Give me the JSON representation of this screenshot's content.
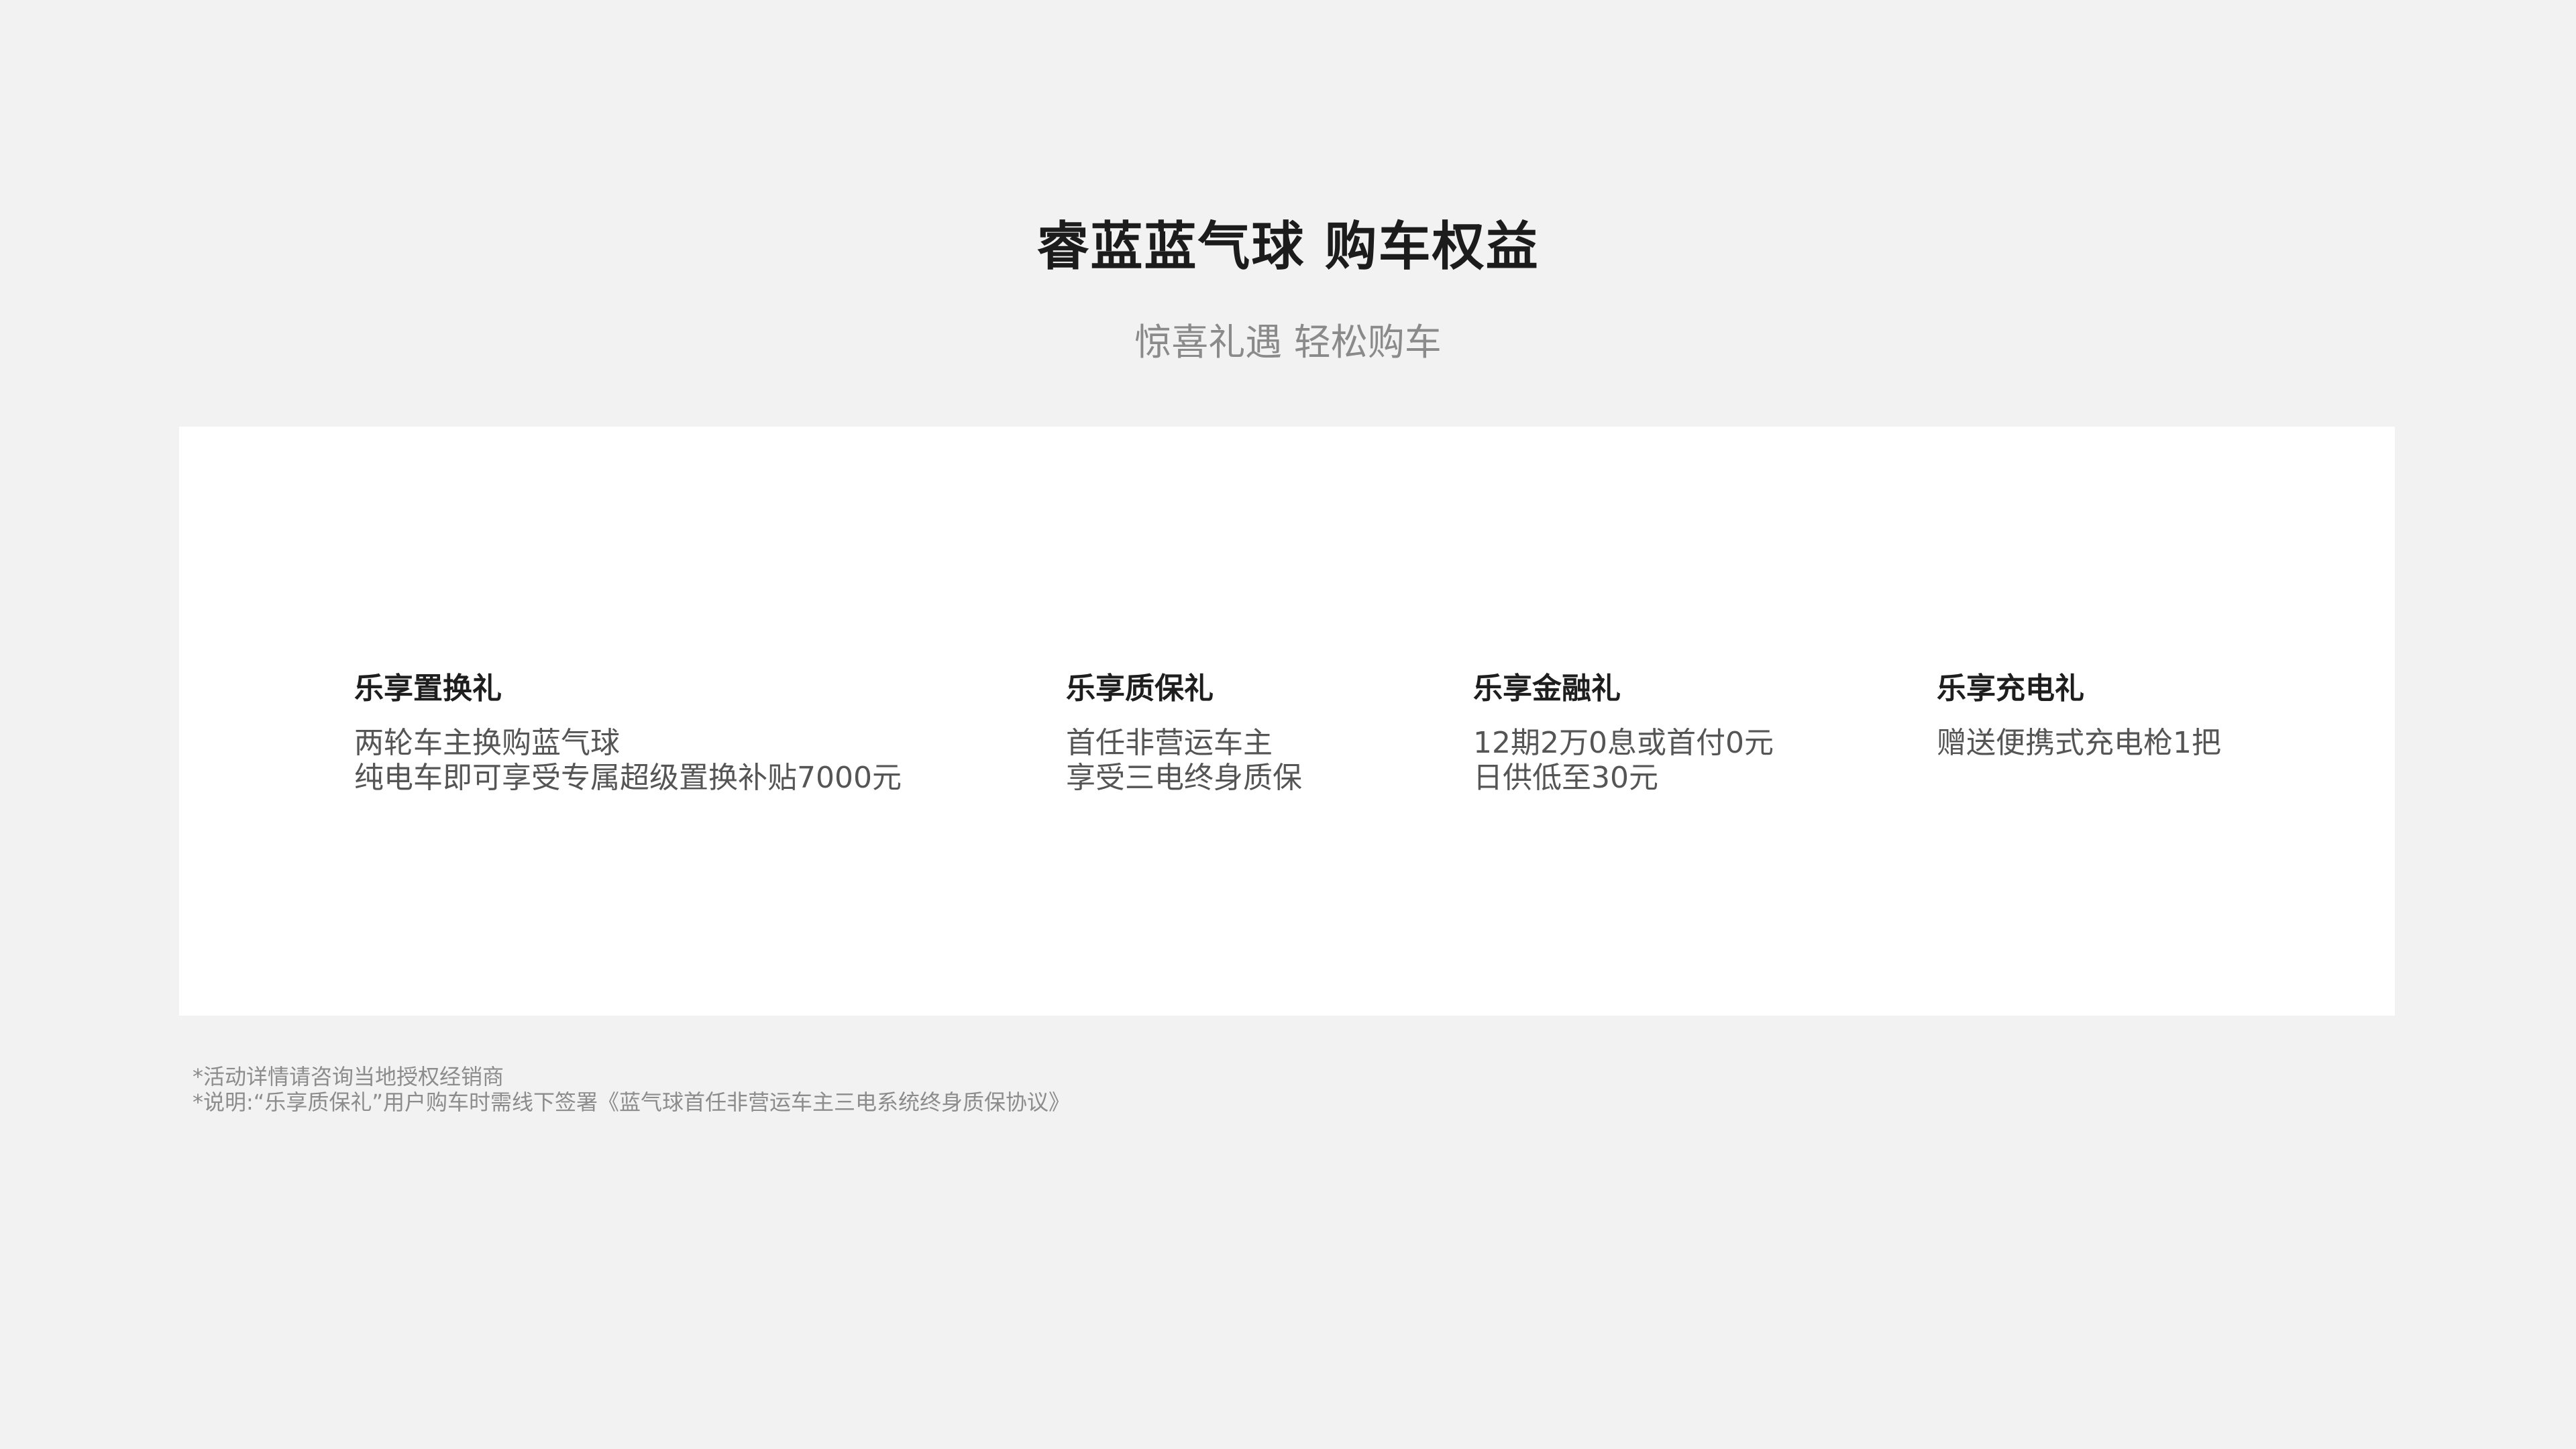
{
  "header": {
    "title": "睿蓝蓝气球 购车权益",
    "subtitle": "惊喜礼遇 轻松购车"
  },
  "benefits": [
    {
      "title": "乐享置换礼",
      "lines": [
        "两轮车主换购蓝气球",
        "纯电车即可享受专属超级置换补贴7000元"
      ]
    },
    {
      "title": "乐享质保礼",
      "lines": [
        "首任非营运车主",
        "享受三电终身质保"
      ]
    },
    {
      "title": "乐享金融礼",
      "lines": [
        "12期2万0息或首付0元",
        "日供低至30元"
      ]
    },
    {
      "title": "乐享充电礼",
      "lines": [
        "赠送便携式充电枪1把"
      ]
    }
  ],
  "footnotes": [
    "*活动详情请咨询当地授权经销商",
    "*说明:“乐享质保礼”用户购车时需线下签署《蓝气球首任非营运车主三电系统终身质保协议》"
  ],
  "colors": {
    "background": "#f2f2f2",
    "card": "#ffffff",
    "title": "#1c1c1c",
    "subtitle": "#8a8a8a",
    "footnote": "#8c8c8c"
  }
}
